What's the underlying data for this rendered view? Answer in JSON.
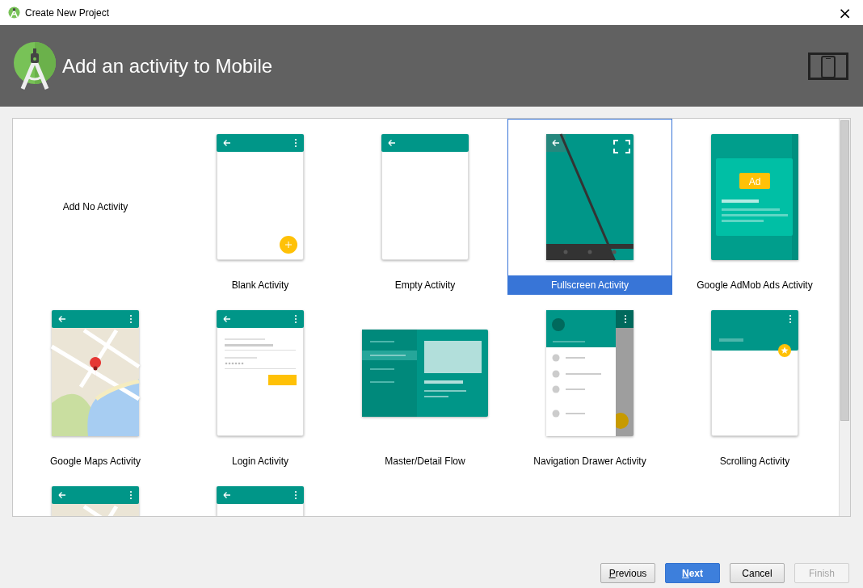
{
  "window": {
    "title": "Create New Project",
    "close": "×"
  },
  "header": {
    "title": "Add an activity to Mobile"
  },
  "activities": [
    {
      "kind": "none",
      "label": "Add No Activity",
      "selected": false
    },
    {
      "kind": "blank",
      "label": "Blank Activity",
      "selected": false
    },
    {
      "kind": "empty",
      "label": "Empty Activity",
      "selected": false
    },
    {
      "kind": "fullscreen",
      "label": "Fullscreen Activity",
      "selected": true
    },
    {
      "kind": "admob",
      "label": "Google AdMob Ads Activity",
      "selected": false,
      "badge": "Ad"
    },
    {
      "kind": "maps",
      "label": "Google Maps Activity",
      "selected": false
    },
    {
      "kind": "login",
      "label": "Login Activity",
      "selected": false
    },
    {
      "kind": "master_detail",
      "label": "Master/Detail Flow",
      "selected": false
    },
    {
      "kind": "nav_drawer",
      "label": "Navigation Drawer Activity",
      "selected": false
    },
    {
      "kind": "scrolling",
      "label": "Scrolling Activity",
      "selected": false
    },
    {
      "kind": "partial_map",
      "selected": false
    },
    {
      "kind": "partial",
      "selected": false
    }
  ],
  "buttons": [
    {
      "label": "Previous",
      "underline_first": true,
      "primary": false,
      "disabled": false
    },
    {
      "label": "Next",
      "underline_first": true,
      "primary": true,
      "disabled": false
    },
    {
      "label": "Cancel",
      "underline_first": false,
      "primary": false,
      "disabled": false
    },
    {
      "label": "Finish",
      "underline_first": false,
      "primary": false,
      "disabled": true
    }
  ]
}
